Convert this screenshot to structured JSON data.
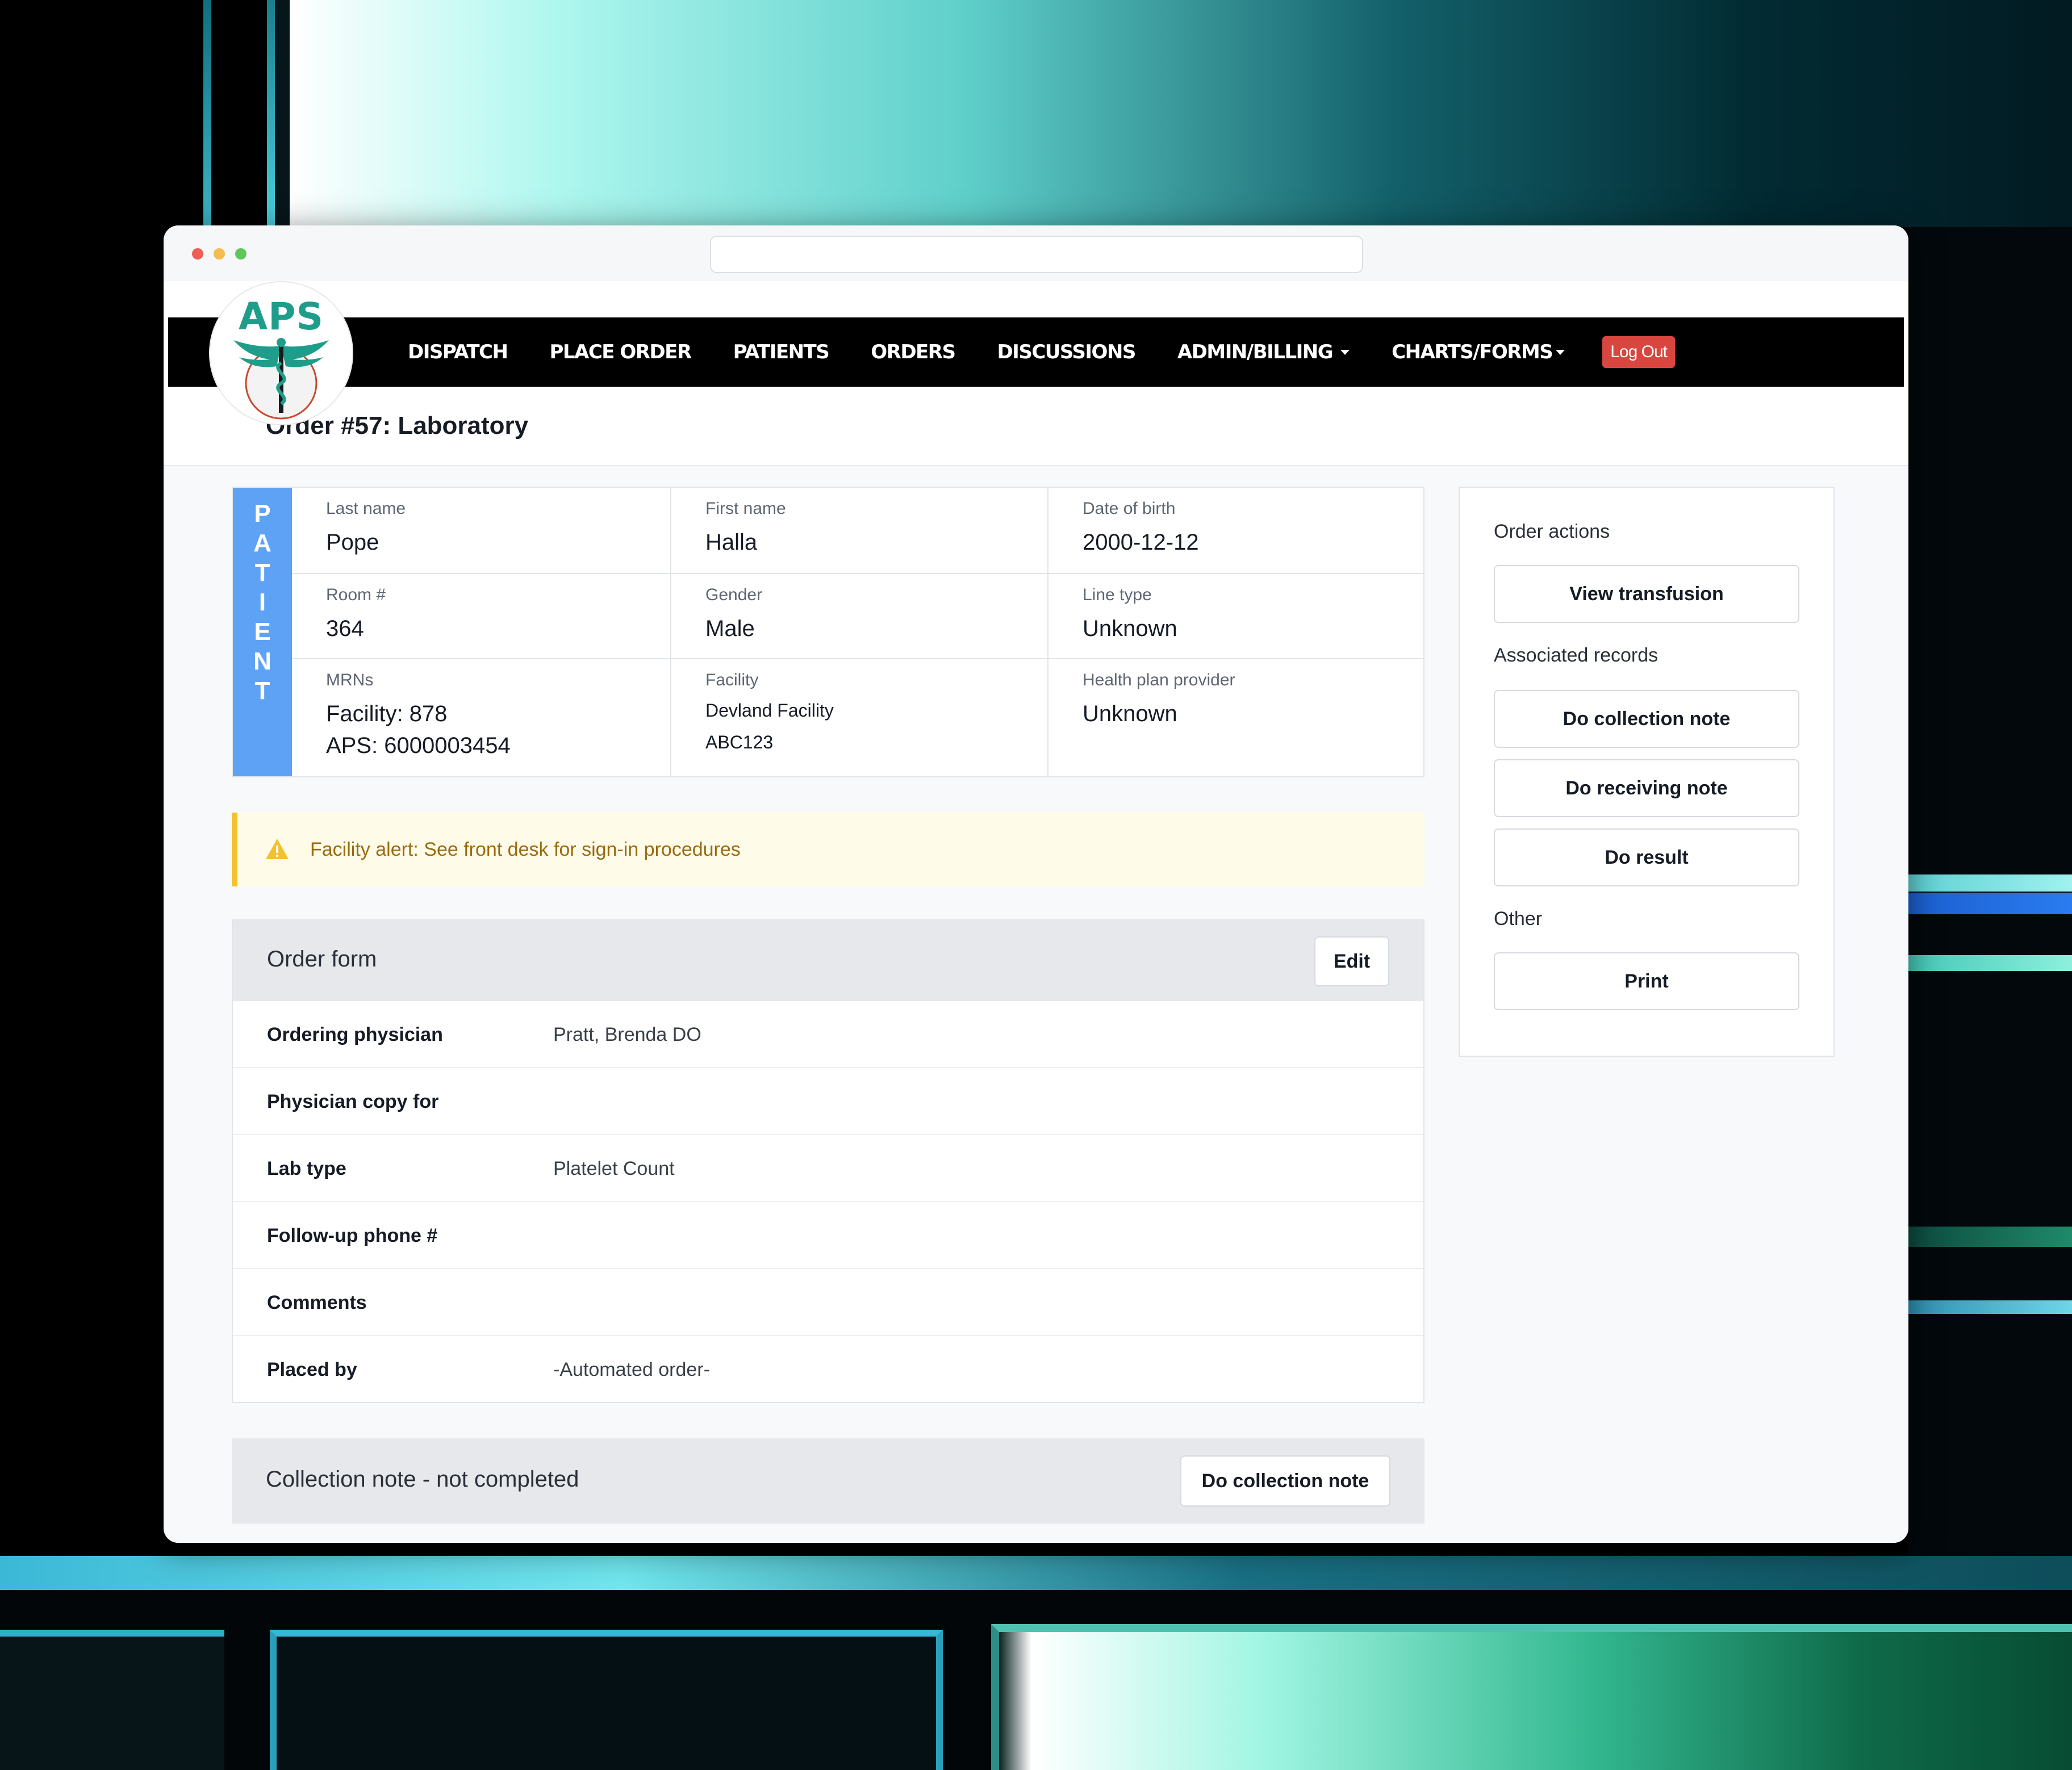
{
  "nav": {
    "logo_text": "APS",
    "items": [
      {
        "label": "DISPATCH"
      },
      {
        "label": "PLACE ORDER"
      },
      {
        "label": "PATIENTS"
      },
      {
        "label": "ORDERS"
      },
      {
        "label": "DISCUSSIONS"
      },
      {
        "label": "ADMIN/BILLING"
      },
      {
        "label": "CHARTS/FORMS"
      }
    ],
    "logout": "Log Out"
  },
  "page": {
    "title": "Order #57: Laboratory"
  },
  "patient": {
    "side_label": [
      "P",
      "A",
      "T",
      "I",
      "E",
      "N",
      "T"
    ],
    "last_name": {
      "label": "Last name",
      "value": "Pope"
    },
    "first_name": {
      "label": "First name",
      "value": "Halla"
    },
    "dob": {
      "label": "Date of birth",
      "value": "2000-12-12"
    },
    "room": {
      "label": "Room #",
      "value": "364"
    },
    "gender": {
      "label": "Gender",
      "value": "Male"
    },
    "line_type": {
      "label": "Line type",
      "value": "Unknown"
    },
    "mrns": {
      "label": "MRNs",
      "facility": "Facility: 878",
      "aps": "APS: 6000003454"
    },
    "facility": {
      "label": "Facility",
      "name": "Devland Facility",
      "code": "ABC123"
    },
    "health_plan": {
      "label": "Health plan provider",
      "value": "Unknown"
    }
  },
  "alert": {
    "text": "Facility alert: See front desk for sign-in procedures"
  },
  "order_form": {
    "title": "Order form",
    "edit_label": "Edit",
    "rows": [
      {
        "key": "Ordering physician",
        "value": "Pratt, Brenda DO"
      },
      {
        "key": "Physician copy for",
        "value": ""
      },
      {
        "key": "Lab type",
        "value": "Platelet Count"
      },
      {
        "key": "Follow-up phone #",
        "value": ""
      },
      {
        "key": "Comments",
        "value": ""
      },
      {
        "key": "Placed by",
        "value": "-Automated order-"
      }
    ]
  },
  "collection": {
    "title": "Collection note - not completed",
    "button": "Do collection note"
  },
  "side": {
    "order_actions": "Order actions",
    "view_transfusion": "View transfusion",
    "associated_records": "Associated records",
    "do_collection_note": "Do collection note",
    "do_receiving_note": "Do receiving note",
    "do_result": "Do result",
    "other": "Other",
    "print": "Print"
  },
  "colors": {
    "nav_bg": "#000000",
    "logout_bg": "#d9463f",
    "patient_side": "#5ea2f5",
    "alert_bg": "#fefbe8",
    "alert_border": "#f2c12e",
    "logo_green": "#1e9e8a"
  }
}
